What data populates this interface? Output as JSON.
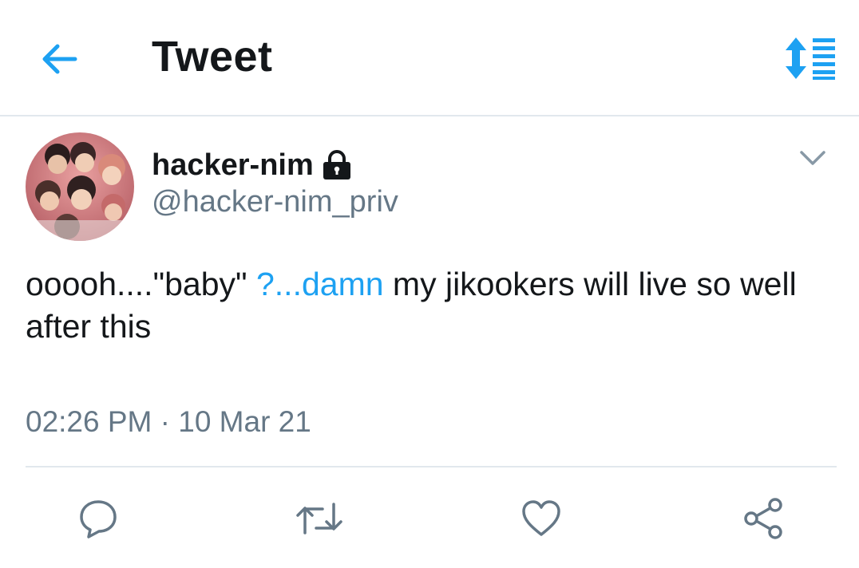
{
  "header": {
    "title": "Tweet",
    "back_icon": "arrow-left-icon",
    "sort_icon": "sort-order-icon",
    "accent_color": "#1da1f2"
  },
  "tweet": {
    "display_name": "hacker-nim",
    "protected_icon": "lock-icon",
    "handle": "@hacker-nim_priv",
    "text_before": "ooooh....\"baby\" ",
    "text_link": "?...damn",
    "text_after": " my jikookers will live so well after this",
    "timestamp": "02:26 PM · 10 Mar 21",
    "menu_icon": "chevron-down-icon"
  },
  "actions": {
    "reply_icon": "reply-icon",
    "retweet_icon": "retweet-icon",
    "like_icon": "heart-icon",
    "share_icon": "share-icon"
  },
  "colors": {
    "text": "#14171a",
    "secondary": "#657786",
    "link": "#1da1f2",
    "divider": "#e1e8ed"
  }
}
